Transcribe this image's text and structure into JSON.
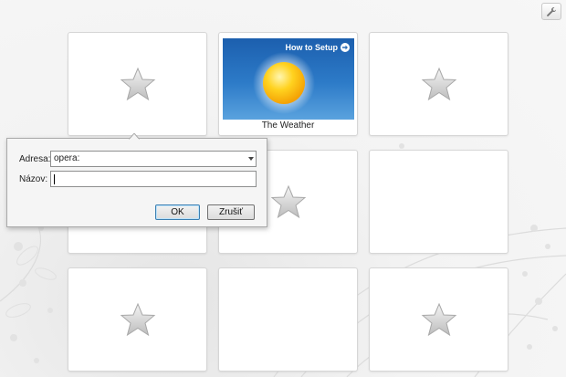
{
  "speed_dial": {
    "settings_icon": "wrench-icon",
    "tiles": [
      {
        "id": "tile-1",
        "type": "empty",
        "icon": "star-icon"
      },
      {
        "id": "tile-2",
        "type": "site",
        "title": "The Weather",
        "overlay_label": "How to Setup",
        "icon": "sun-icon"
      },
      {
        "id": "tile-3",
        "type": "empty",
        "icon": "star-icon"
      },
      {
        "id": "tile-4",
        "type": "empty",
        "icon": "star-icon"
      },
      {
        "id": "tile-5",
        "type": "empty",
        "icon": "star-icon"
      },
      {
        "id": "tile-6",
        "type": "empty",
        "icon": "none"
      },
      {
        "id": "tile-7",
        "type": "empty",
        "icon": "star-icon"
      },
      {
        "id": "tile-8",
        "type": "empty",
        "icon": "none"
      },
      {
        "id": "tile-9",
        "type": "empty",
        "icon": "star-icon"
      }
    ]
  },
  "dialog": {
    "address_label": "Adresa:",
    "address_value": "opera:",
    "name_label": "Názov:",
    "name_value": "",
    "ok_label": "OK",
    "cancel_label": "Zrušiť"
  },
  "colors": {
    "weather_sky": "#2d7bc8",
    "ok_focus": "#3c7fb1"
  }
}
